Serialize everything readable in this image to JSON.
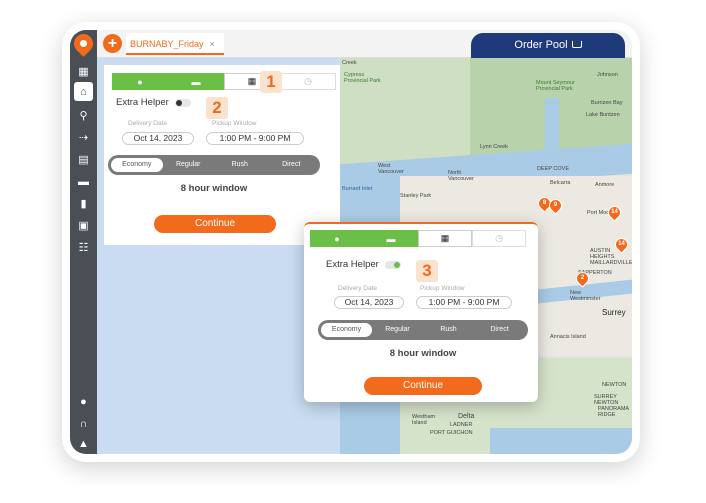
{
  "tab": {
    "label": "BURNABY_Friday",
    "close": "×",
    "add": "+"
  },
  "order_pool": {
    "label": "Order Pool"
  },
  "sidebar": {
    "icons": [
      "dashboard-icon",
      "home-icon",
      "search-icon",
      "route-icon",
      "archive-icon",
      "truck-icon",
      "bookmark-icon",
      "store-icon",
      "team-icon",
      "account-icon",
      "headset-icon",
      "bell-icon"
    ]
  },
  "badges": {
    "one": "1",
    "two": "2",
    "three": "3"
  },
  "form": {
    "extra_helper": "Extra Helper",
    "delivery_date_label": "Delivery Date",
    "delivery_date": "Oct 14, 2023",
    "pickup_window_label": "Pickup Window",
    "pickup_window": "1:00 PM - 9:00 PM",
    "rates": [
      "Economy",
      "Regular",
      "Rush",
      "Direct"
    ],
    "window_text": "8 hour window",
    "continue": "Continue"
  },
  "map_labels": {
    "cypress": "Cypress Provincial Park",
    "mount": "Mount Seymour Provincial Park",
    "johnson": "Johnson",
    "burrizen": "Burrizen Bay",
    "lake": "Lake Buntzen",
    "lynn": "Lynn Creek",
    "west_van": "West Vancouver",
    "north_van": "North Vancouver",
    "deep_cove": "DEEP COVE",
    "belcarra": "Belcarra",
    "anmore": "Anmore",
    "stanley": "Stanley Park",
    "burrard": "Burrard Inlet",
    "port_moody": "Port Moody",
    "austin": "AUSTIN HEIGHTS",
    "maillardville": "MAILLARDVILLE",
    "sapperton": "SAPPERTON",
    "new_west": "New Westminster",
    "surrey": "Surrey",
    "annacis": "Annacis Island",
    "newton": "NEWTON",
    "surrey_newton": "SURREY NEWTON",
    "panorama": "PANORAMA RIDGE",
    "westham": "Westham Island",
    "delta": "Delta",
    "ladner": "LADNER",
    "port_guichon": "PORT GUICHON",
    "creek": "Creek"
  },
  "pins": [
    "8",
    "9",
    "14",
    "14",
    "2"
  ],
  "colors": {
    "accent": "#f26a1b",
    "green": "#6cbf46",
    "navy": "#1f3a7a",
    "sidebar": "#4a4f56"
  }
}
